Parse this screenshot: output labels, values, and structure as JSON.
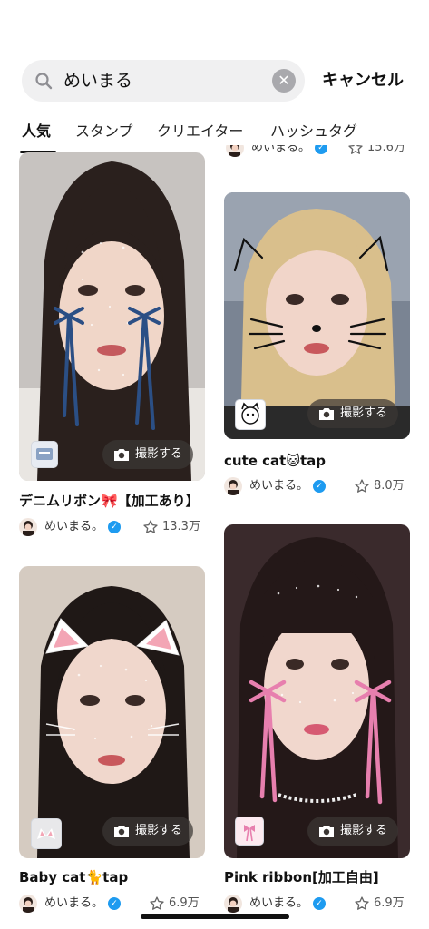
{
  "search": {
    "query": "めいまる",
    "cancel_label": "キャンセル"
  },
  "tabs": [
    {
      "label": "人気",
      "active": true
    },
    {
      "label": "スタンプ",
      "active": false
    },
    {
      "label": "クリエイター",
      "active": false
    },
    {
      "label": "ハッシュタグ",
      "active": false
    }
  ],
  "colors": {
    "verified": "#1e9bf0",
    "pill_bg": "#3c3734",
    "search_bg": "#f0f0f1"
  },
  "top_strip": {
    "author": "めいまる。",
    "count_partial": "15.6万"
  },
  "cards": [
    {
      "title": "デニムリボン🎀【加工あり】",
      "shoot_label": "撮影する",
      "author": "めいまる。",
      "count": "13.3万",
      "ribbon_color": "#2b4f85",
      "badge_text": "denim ribbon"
    },
    {
      "title": "cute cat🐱tap",
      "shoot_label": "撮影する",
      "author": "めいまる。",
      "count": "8.0万",
      "badge_icon": "cat-face-icon"
    },
    {
      "title": "Baby cat🐈tap",
      "shoot_label": "撮影する",
      "author": "めいまる。",
      "count": "6.9万",
      "badge_icon": "cat-ears-icon"
    },
    {
      "title": "Pink ribbon[加工自由]",
      "shoot_label": "撮影する",
      "author": "めいまる。",
      "count": "6.9万",
      "ribbon_color": "#e77fae",
      "badge_icon": "ribbon-icon"
    }
  ]
}
